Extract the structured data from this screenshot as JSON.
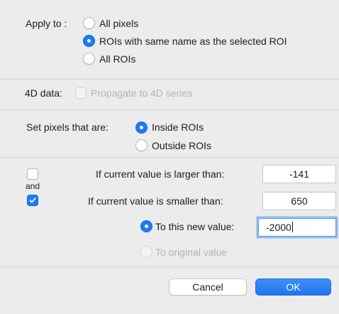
{
  "apply_to": {
    "label": "Apply to :",
    "options": [
      {
        "label": "All pixels",
        "selected": false
      },
      {
        "label": "ROIs with same name as the selected ROI",
        "selected": true
      },
      {
        "label": "All ROIs",
        "selected": false
      }
    ]
  },
  "data_4d": {
    "label": "4D data:",
    "checkbox_label": "Propagate to 4D series",
    "checked": false,
    "enabled": false
  },
  "set_pixels": {
    "label": "Set pixels that are:",
    "options": [
      {
        "label": "Inside ROIs",
        "selected": true
      },
      {
        "label": "Outside ROIs",
        "selected": false
      }
    ]
  },
  "conditions": {
    "larger_checked": false,
    "and_label": "and",
    "smaller_checked": true,
    "larger_label": "If current value is larger than:",
    "larger_value": "-141",
    "smaller_label": "If current value is smaller than:",
    "smaller_value": "650"
  },
  "replacement": {
    "new_value_label": "To this new value:",
    "new_value": "-2000",
    "new_value_selected": true,
    "original_label": "To original value",
    "original_enabled": false
  },
  "buttons": {
    "cancel": "Cancel",
    "ok": "OK"
  },
  "colors": {
    "accent": "#1a7cf5",
    "background": "#ececec"
  }
}
